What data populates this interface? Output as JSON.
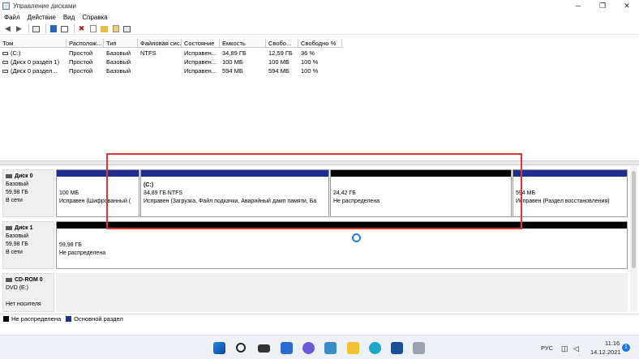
{
  "window": {
    "title": "Управление дисками"
  },
  "menu": [
    "Файл",
    "Действие",
    "Вид",
    "Справка"
  ],
  "columns": [
    "Том",
    "Располож...",
    "Тип",
    "Файловая сис...",
    "Состояние",
    "Емкость",
    "Свобо...",
    "Свободно %"
  ],
  "volumes": [
    [
      "(C:)",
      "Простой",
      "Базовый",
      "NTFS",
      "Исправен...",
      "34,89 ГБ",
      "12,59 ГБ",
      "36 %"
    ],
    [
      "(Диск 0 раздел 1)",
      "Простой",
      "Базовый",
      "",
      "Исправен...",
      "100 МБ",
      "100 МБ",
      "100 %"
    ],
    [
      "(Диск 0 раздел...",
      "Простой",
      "Базовый",
      "",
      "Исправен...",
      "594 МБ",
      "594 МБ",
      "100 %"
    ]
  ],
  "disks": [
    {
      "name": "Диск 0",
      "type": "Базовый",
      "size": "59,98 ГБ",
      "status": "В сети",
      "partitions": [
        {
          "label": "",
          "size": "100 МБ",
          "status": "Исправен (Шифрованный (",
          "bar": "blue"
        },
        {
          "label": "(C:)",
          "size": "34,89 ГБ NTFS",
          "status": "Исправен (Загрузка, Файл подкачки, Аварийный дамп памяти, Ба",
          "bar": "blue"
        },
        {
          "label": "",
          "size": "24,42 ГБ",
          "status": "Не распределена",
          "bar": "black"
        },
        {
          "label": "",
          "size": "594 МБ",
          "status": "Исправен (Раздел восстановления)",
          "bar": "blue"
        }
      ]
    },
    {
      "name": "Диск 1",
      "type": "Базовый",
      "size": "59,98 ГБ",
      "status": "В сети",
      "partitions": [
        {
          "label": "",
          "size": "59,98 ГБ",
          "status": "Не распределена",
          "bar": "black"
        }
      ]
    },
    {
      "name": "CD-ROM 0",
      "type": "DVD (E:)",
      "size": "",
      "status": "Нет носителя",
      "partitions": []
    }
  ],
  "legend": [
    {
      "label": "Не распределена",
      "color": "#000000"
    },
    {
      "label": "Основной раздел",
      "color": "#1f2f8f"
    }
  ],
  "tray": {
    "lang": "РУС",
    "time": "11:16",
    "date": "14.12.2021",
    "badge": "1"
  },
  "icons": {
    "back": "◀",
    "forward": "▶",
    "delete": "✖",
    "min": "─",
    "max": "❐",
    "close": "✕"
  }
}
